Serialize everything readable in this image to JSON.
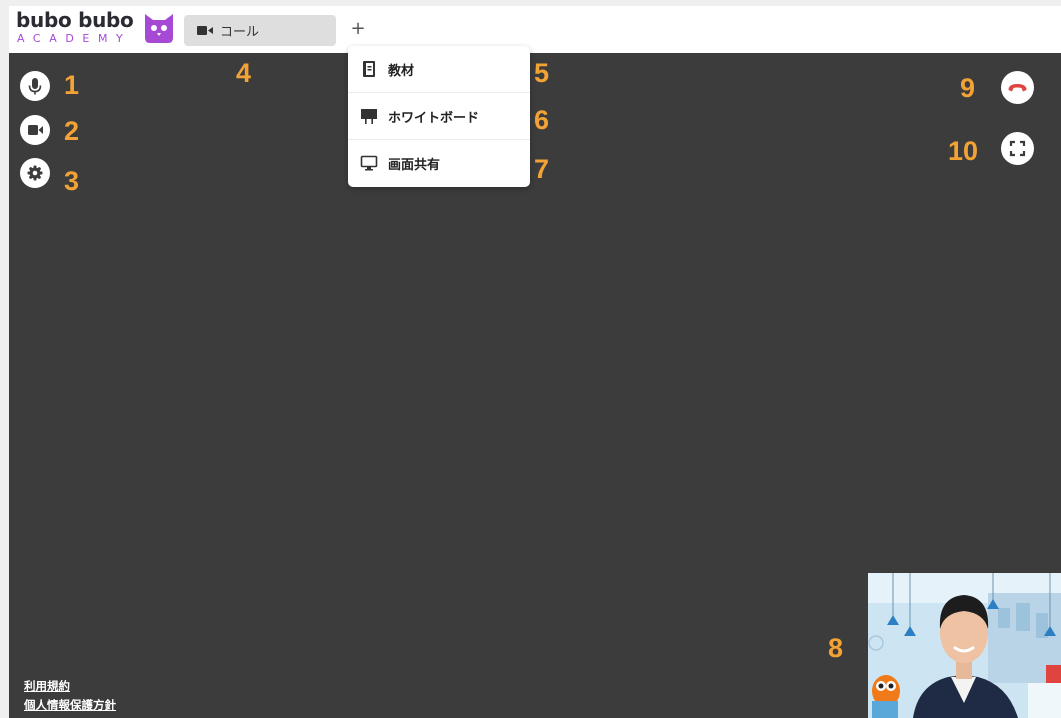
{
  "header": {
    "logo_text": "bubo bubo",
    "logo_sub": "ACADEMY",
    "tab_label": "コール",
    "add_tab_label": "+"
  },
  "controls": {
    "mic_icon": "microphone-icon",
    "camera_icon": "video-camera-icon",
    "settings_icon": "gear-icon",
    "end_call_icon": "phone-hangup-icon",
    "fullscreen_icon": "fullscreen-icon"
  },
  "menu": {
    "items": [
      {
        "label": "教材",
        "icon": "book-icon"
      },
      {
        "label": "ホワイトボード",
        "icon": "whiteboard-icon"
      },
      {
        "label": "画面共有",
        "icon": "monitor-icon"
      }
    ]
  },
  "annotations": {
    "n1": "1",
    "n2": "2",
    "n3": "3",
    "n4": "4",
    "n5": "5",
    "n6": "6",
    "n7": "7",
    "n8": "8",
    "n9": "9",
    "n10": "10"
  },
  "footer": {
    "terms": "利用規約",
    "privacy": "個人情報保護方針"
  },
  "colors": {
    "stage": "#3c3c3c",
    "accent": "#a64ad6",
    "marker": "#f3a335",
    "hangup": "#e0443e"
  }
}
